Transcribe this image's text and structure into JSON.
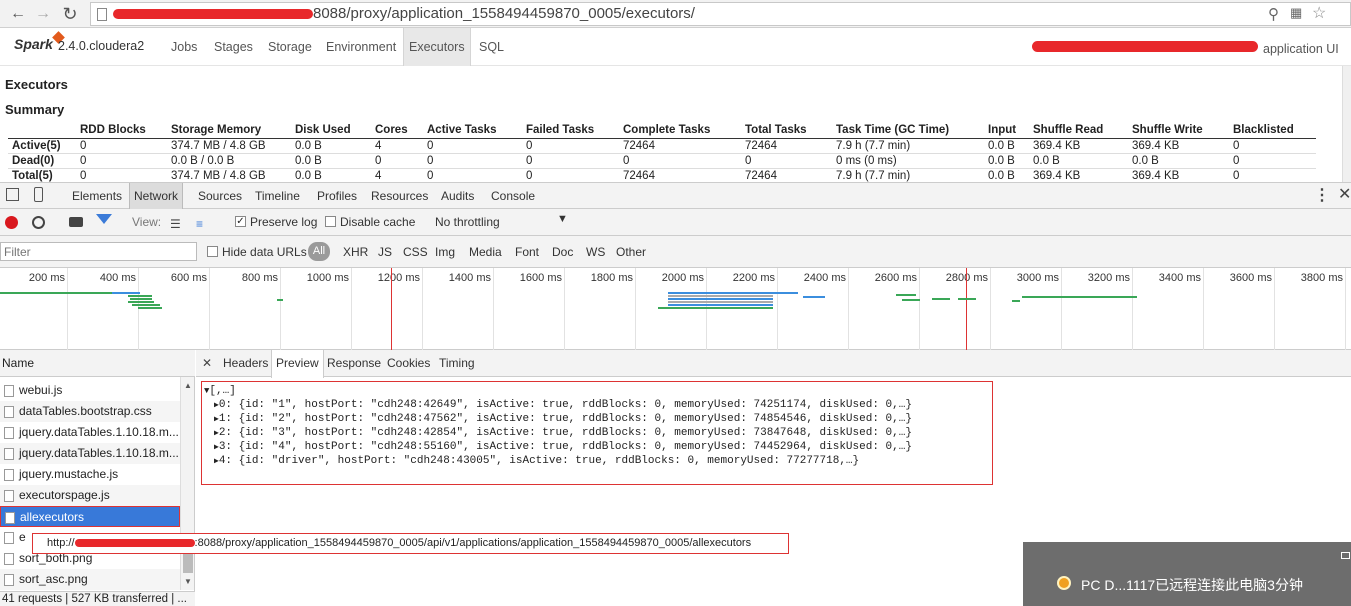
{
  "browser": {
    "url_suffix": "8088/proxy/application_1558494459870_0005/executors/",
    "back_icon": "arrow-left-icon",
    "forward_icon": "arrow-right-icon",
    "reload_icon": "reload-icon"
  },
  "spark": {
    "version": "2.4.0.cloudera2",
    "logo": "Spark",
    "tabs": [
      "Jobs",
      "Stages",
      "Storage",
      "Environment",
      "Executors",
      "SQL"
    ],
    "active_tab": "Executors",
    "app_ui_label": "application UI"
  },
  "page": {
    "heading": "Executors",
    "summary_heading": "Summary",
    "columns": [
      "",
      "RDD Blocks",
      "Storage Memory",
      "Disk Used",
      "Cores",
      "Active Tasks",
      "Failed Tasks",
      "Complete Tasks",
      "Total Tasks",
      "Task Time (GC Time)",
      "Input",
      "Shuffle Read",
      "Shuffle Write",
      "Blacklisted"
    ],
    "rows": [
      [
        "Active(5)",
        "0",
        "374.7 MB / 4.8 GB",
        "0.0 B",
        "4",
        "0",
        "0",
        "72464",
        "72464",
        "7.9 h (7.7 min)",
        "0.0 B",
        "369.4 KB",
        "369.4 KB",
        "0"
      ],
      [
        "Dead(0)",
        "0",
        "0.0 B / 0.0 B",
        "0.0 B",
        "0",
        "0",
        "0",
        "0",
        "0",
        "0 ms (0 ms)",
        "0.0 B",
        "0.0 B",
        "0.0 B",
        "0"
      ],
      [
        "Total(5)",
        "0",
        "374.7 MB / 4.8 GB",
        "0.0 B",
        "4",
        "0",
        "0",
        "72464",
        "72464",
        "7.9 h (7.7 min)",
        "0.0 B",
        "369.4 KB",
        "369.4 KB",
        "0"
      ]
    ]
  },
  "devtools": {
    "tabs": [
      "Elements",
      "Network",
      "Sources",
      "Timeline",
      "Profiles",
      "Resources",
      "Audits",
      "Console"
    ],
    "active_tab": "Network",
    "view_label": "View:",
    "preserve_log": "Preserve log",
    "disable_cache": "Disable cache",
    "throttling": "No throttling",
    "filter_placeholder": "Filter",
    "hide_data_urls": "Hide data URLs",
    "filter_types": [
      "All",
      "XHR",
      "JS",
      "CSS",
      "Img",
      "Media",
      "Font",
      "Doc",
      "WS",
      "Other"
    ],
    "timeline_ticks": [
      "200 ms",
      "400 ms",
      "600 ms",
      "800 ms",
      "1000 ms",
      "1200 ms",
      "1400 ms",
      "1600 ms",
      "1800 ms",
      "2000 ms",
      "2200 ms",
      "2400 ms",
      "2600 ms",
      "2800 ms",
      "3000 ms",
      "3200 ms",
      "3400 ms",
      "3600 ms",
      "3800 ms"
    ],
    "name_header": "Name",
    "files": [
      "webui.js",
      "dataTables.bootstrap.css",
      "jquery.dataTables.1.10.18.m...",
      "jquery.dataTables.1.10.18.m...",
      "jquery.mustache.js",
      "executorspage.js",
      "allexecutors",
      "e",
      "sort_both.png",
      "sort_asc.png"
    ],
    "selected_file": "allexecutors",
    "status": "41 requests  |  527 KB transferred  |  ...",
    "detail_tabs": [
      "Headers",
      "Preview",
      "Response",
      "Cookies",
      "Timing"
    ],
    "active_detail_tab": "Preview",
    "preview_root": "[,…]",
    "preview_lines": [
      "0: {id: \"1\", hostPort: \"cdh248:42649\", isActive: true, rddBlocks: 0, memoryUsed: 74251174, diskUsed: 0,…}",
      "1: {id: \"2\", hostPort: \"cdh248:47562\", isActive: true, rddBlocks: 0, memoryUsed: 74854546, diskUsed: 0,…}",
      "2: {id: \"3\", hostPort: \"cdh248:42854\", isActive: true, rddBlocks: 0, memoryUsed: 73847648, diskUsed: 0,…}",
      "3: {id: \"4\", hostPort: \"cdh248:55160\", isActive: true, rddBlocks: 0, memoryUsed: 74452964, diskUsed: 0,…}",
      "4: {id: \"driver\", hostPort: \"cdh248:43005\", isActive: true, rddBlocks: 0, memoryUsed: 77277718,…}"
    ],
    "tooltip_prefix": "http://",
    "tooltip_suffix": ":8088/proxy/application_1558494459870_0005/api/v1/applications/application_1558494459870_0005/allexecutors"
  },
  "notification": {
    "text": "PC  D...1117已远程连接此电脑3分钟"
  }
}
